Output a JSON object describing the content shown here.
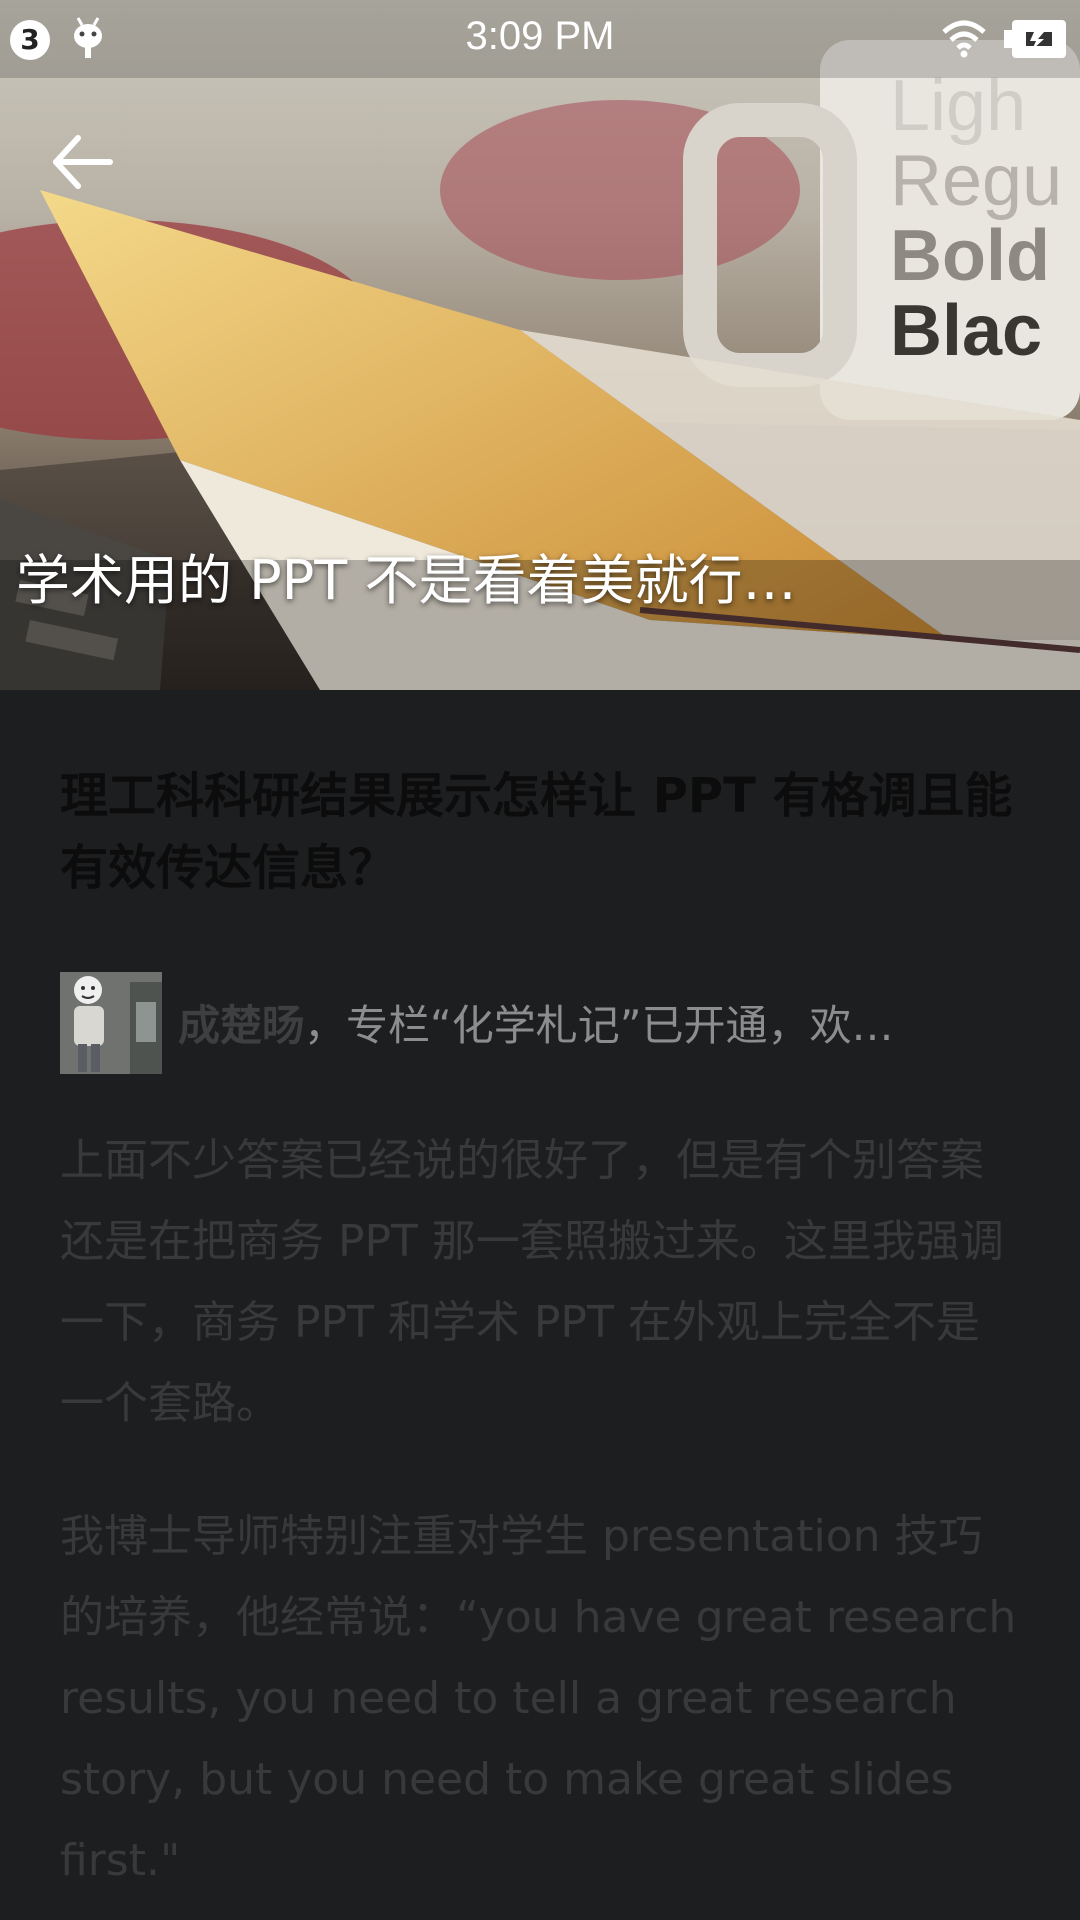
{
  "status_bar": {
    "notification_count": "3",
    "time": "3:09 PM"
  },
  "hero": {
    "title": "学术用的 PPT 不是看着美就行…"
  },
  "question": {
    "title": "理工科科研结果展示怎样让 PPT 有格调且能有效传达信息？"
  },
  "answer": {
    "author_name": "成楚旸",
    "author_bio": "，专栏“化学札记”已开通，欢…",
    "paragraphs": [
      "上面不少答案已经说的很好了，但是有个别答案还是在把商务 PPT 那一套照搬过来。这里我强调一下，商务 PPT 和学术 PPT 在外观上完全不是一个套路。",
      "我博士导师特别注重对学生 presentation 技巧的培养，他经常说：“you have great research results, you need to tell a great research story, but you need to make great slides first.\""
    ]
  },
  "icons": {
    "back": "arrow-back-icon",
    "android": "android-debug-icon",
    "wifi": "wifi-icon",
    "battery": "battery-charging-icon"
  }
}
